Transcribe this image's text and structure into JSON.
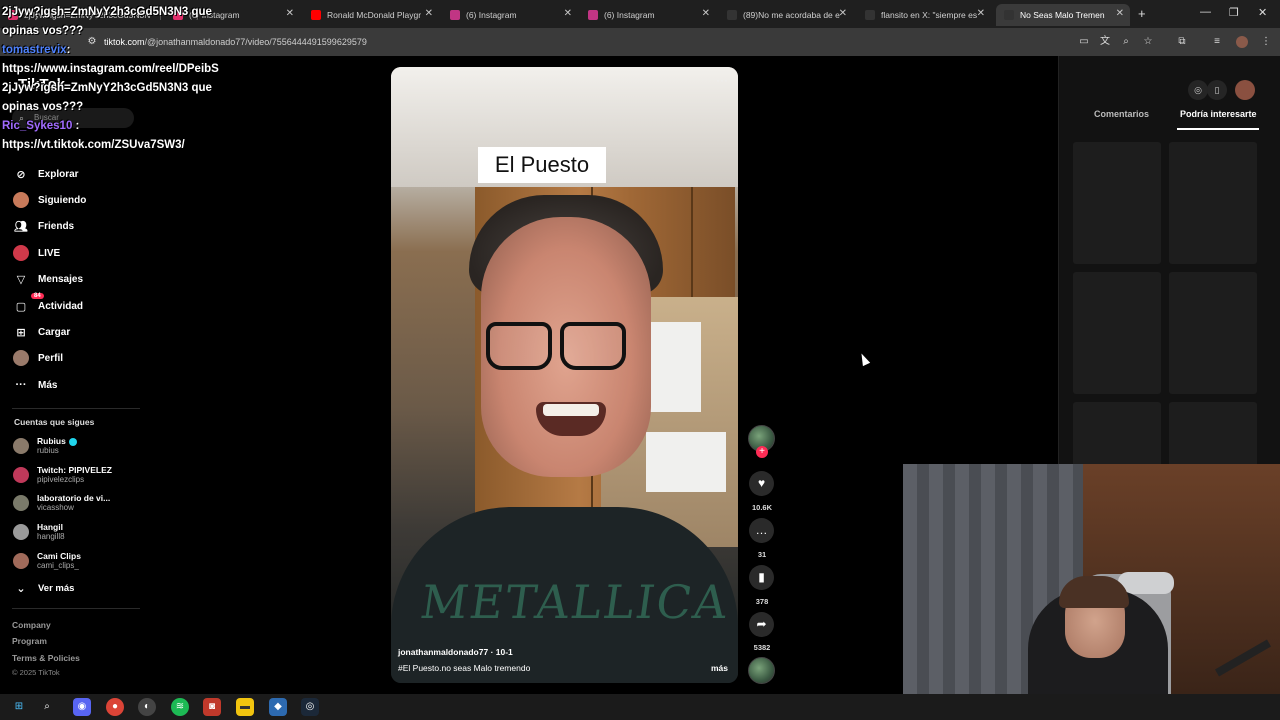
{
  "browser": {
    "tabs": [
      {
        "label": "2jJyw?igsh=ZmNyY2h3cGd5N3N3 que",
        "favicon_color": "#e1306c"
      },
      {
        "label": "(6) Instagram",
        "favicon_color": "#e1306c"
      },
      {
        "label": "Ronald McDonald Playgr",
        "favicon_color": "#ff0000"
      },
      {
        "label": "(6) Instagram",
        "favicon_color": "#c13584"
      },
      {
        "label": "(6) Instagram",
        "favicon_color": "#c13584"
      },
      {
        "label": "(89)No me acordaba de e",
        "favicon_color": "#000000"
      },
      {
        "label": "flansito en X: \"siempre es",
        "favicon_color": "#000000"
      },
      {
        "label": "No Seas Malo Tremen",
        "favicon_color": "#000000"
      }
    ],
    "new_tab": "+",
    "url_domain": "tiktok.com",
    "url_path": "/@jonathanmaldonado77/video/7556444491599629579"
  },
  "chat_overlay": {
    "line1": "2jJyw?igsh=ZmNyY2h3cGd5N3N3 que",
    "line2": "opinas vos???",
    "user1": "tomastrevix",
    "user1_suffix": ":",
    "line3": "https://www.instagram.com/reel/DPeibS",
    "line4": "2jJyw?igsh=ZmNyY2h3cGd5N3N3 que",
    "line5": "opinas vos???",
    "user2": "Ric_Sykes10",
    "user2_suffix": " :",
    "line6": "https://vt.tiktok.com/ZSUva7SW3/"
  },
  "sidebar": {
    "logo": "TikTok",
    "search_placeholder": "Buscar",
    "nav": [
      {
        "label": "Explorar",
        "icon": "compass-icon"
      },
      {
        "label": "Siguiendo",
        "icon": "following-icon"
      },
      {
        "label": "Friends",
        "icon": "friends-icon"
      },
      {
        "label": "LIVE",
        "icon": "live-icon"
      },
      {
        "label": "Mensajes",
        "icon": "messages-icon"
      },
      {
        "label": "Actividad",
        "icon": "activity-icon",
        "badge": "84"
      },
      {
        "label": "Cargar",
        "icon": "upload-icon"
      },
      {
        "label": "Perfil",
        "icon": "profile-icon"
      },
      {
        "label": "Más",
        "icon": "more-icon"
      }
    ],
    "following_title": "Cuentas que sigues",
    "following": [
      {
        "name": "Rubius",
        "handle": "rubius",
        "verified": true,
        "color": "#8a7a6a"
      },
      {
        "name": "Twitch: PIPIVELEZ",
        "handle": "pipivelezclips",
        "verified": false,
        "color": "#c0395a"
      },
      {
        "name": "laboratorio de vi...",
        "handle": "vicasshow",
        "verified": false,
        "color": "#7a7a6a"
      },
      {
        "name": "Hangil",
        "handle": "hangill8",
        "verified": false,
        "color": "#9a9a9a"
      },
      {
        "name": "Cami Clips",
        "handle": "cami_clips_",
        "verified": false,
        "color": "#a06a5a"
      }
    ],
    "see_more": "Ver más",
    "footer": [
      "Company",
      "Program",
      "Terms & Policies"
    ],
    "copyright": "© 2025 TikTok"
  },
  "video": {
    "overlay_title": "El Puesto",
    "shirt_text": "METALLICA",
    "author": "jonathanmaldonado77 · 10-1",
    "description": "#El  Puesto.no seas Malo tremendo",
    "more": "más",
    "menu": "···"
  },
  "actions": {
    "likes": "10.6K",
    "comments": "31",
    "saves": "378",
    "shares": "5382"
  },
  "right_panel": {
    "tab_comments": "Comentarios",
    "tab_suggested": "Podría interesarte"
  },
  "colors": {
    "accent": "#fe2c55",
    "verified": "#20d5ec"
  }
}
